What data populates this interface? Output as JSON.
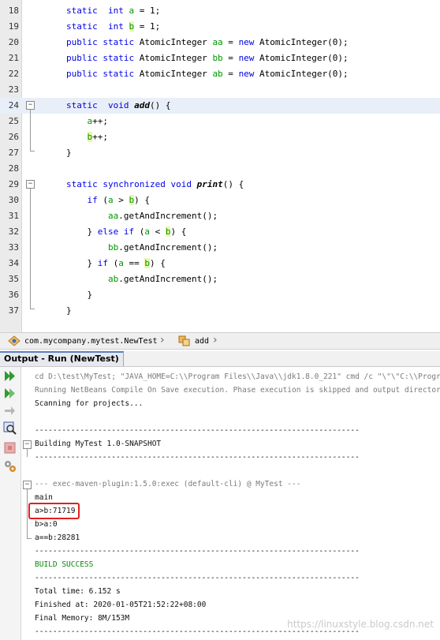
{
  "editor": {
    "lines": [
      {
        "n": "18",
        "html": "<span class='kw'>static</span>  <span class='kw'>int</span> <span class='fld'>a</span> = 1;"
      },
      {
        "n": "19",
        "html": "<span class='kw'>static</span>  <span class='kw'>int</span> <span class='fld hlv'>b</span> = 1;"
      },
      {
        "n": "20",
        "html": "<span class='kw'>public static</span> AtomicInteger <span class='fld'>aa</span> = <span class='kw'>new</span> AtomicInteger(0);"
      },
      {
        "n": "21",
        "html": "<span class='kw'>public static</span> AtomicInteger <span class='fld'>bb</span> = <span class='kw'>new</span> AtomicInteger(0);"
      },
      {
        "n": "22",
        "html": "<span class='kw'>public static</span> AtomicInteger <span class='fld'>ab</span> = <span class='kw'>new</span> AtomicInteger(0);"
      },
      {
        "n": "23",
        "html": ""
      },
      {
        "n": "24",
        "html": "<span class='kw'>static</span>  <span class='kw'>void</span> <span class='mth'>add</span>() {"
      },
      {
        "n": "25",
        "html": "    <span class='fld'>a</span>++;"
      },
      {
        "n": "26",
        "html": "    <span class='fld hlv'>b</span>++;"
      },
      {
        "n": "27",
        "html": "}"
      },
      {
        "n": "28",
        "html": ""
      },
      {
        "n": "29",
        "html": "<span class='kw'>static synchronized void</span> <span class='mth'>print</span>() {"
      },
      {
        "n": "30",
        "html": "    <span class='kw'>if</span> (<span class='fld'>a</span> &gt; <span class='fld hlv'>b</span>) {"
      },
      {
        "n": "31",
        "html": "        <span class='fld'>aa</span>.getAndIncrement();"
      },
      {
        "n": "32",
        "html": "    } <span class='kw'>else if</span> (<span class='fld'>a</span> &lt; <span class='fld hlv'>b</span>) {"
      },
      {
        "n": "33",
        "html": "        <span class='fld'>bb</span>.getAndIncrement();"
      },
      {
        "n": "34",
        "html": "    } <span class='kw'>if</span> (<span class='fld'>a</span> == <span class='fld hlv'>b</span>) {"
      },
      {
        "n": "35",
        "html": "        <span class='fld'>ab</span>.getAndIncrement();"
      },
      {
        "n": "36",
        "html": "    }"
      },
      {
        "n": "37",
        "html": "}"
      }
    ]
  },
  "breadcrumb": {
    "class_path": "com.mycompany.mytest.NewTest",
    "method": "add"
  },
  "output": {
    "tab_label": "Output - Run (NewTest)",
    "lines": [
      {
        "cls": "grey",
        "text": "cd D:\\test\\MyTest; \"JAVA_HOME=C:\\\\Program Files\\\\Java\\\\jdk1.8.0_221\" cmd /c \"\\\"\\\"C:\\\\Program"
      },
      {
        "cls": "grey",
        "text": "Running NetBeans Compile On Save execution. Phase execution is skipped and output directories"
      },
      {
        "cls": "",
        "text": "Scanning for projects..."
      },
      {
        "cls": "",
        "text": ""
      },
      {
        "cls": "",
        "text": "------------------------------------------------------------------------"
      },
      {
        "cls": "",
        "text": "Building MyTest 1.0-SNAPSHOT"
      },
      {
        "cls": "",
        "text": "------------------------------------------------------------------------"
      },
      {
        "cls": "",
        "text": ""
      },
      {
        "cls": "grey",
        "text": "--- exec-maven-plugin:1.5.0:exec (default-cli) @ MyTest ---"
      },
      {
        "cls": "",
        "text": "main"
      },
      {
        "cls": "",
        "text": "a>b:71719"
      },
      {
        "cls": "",
        "text": "b>a:0"
      },
      {
        "cls": "",
        "text": "a==b:28281"
      },
      {
        "cls": "",
        "text": "------------------------------------------------------------------------"
      },
      {
        "cls": "green",
        "text": "BUILD SUCCESS"
      },
      {
        "cls": "",
        "text": "------------------------------------------------------------------------"
      },
      {
        "cls": "",
        "text": "Total time: 6.152 s"
      },
      {
        "cls": "",
        "text": "Finished at: 2020-01-05T21:52:22+08:00"
      },
      {
        "cls": "",
        "text": "Final Memory: 8M/153M"
      },
      {
        "cls": "",
        "text": "------------------------------------------------------------------------"
      }
    ]
  },
  "watermark": "https://linuxstyle.blog.csdn.net"
}
